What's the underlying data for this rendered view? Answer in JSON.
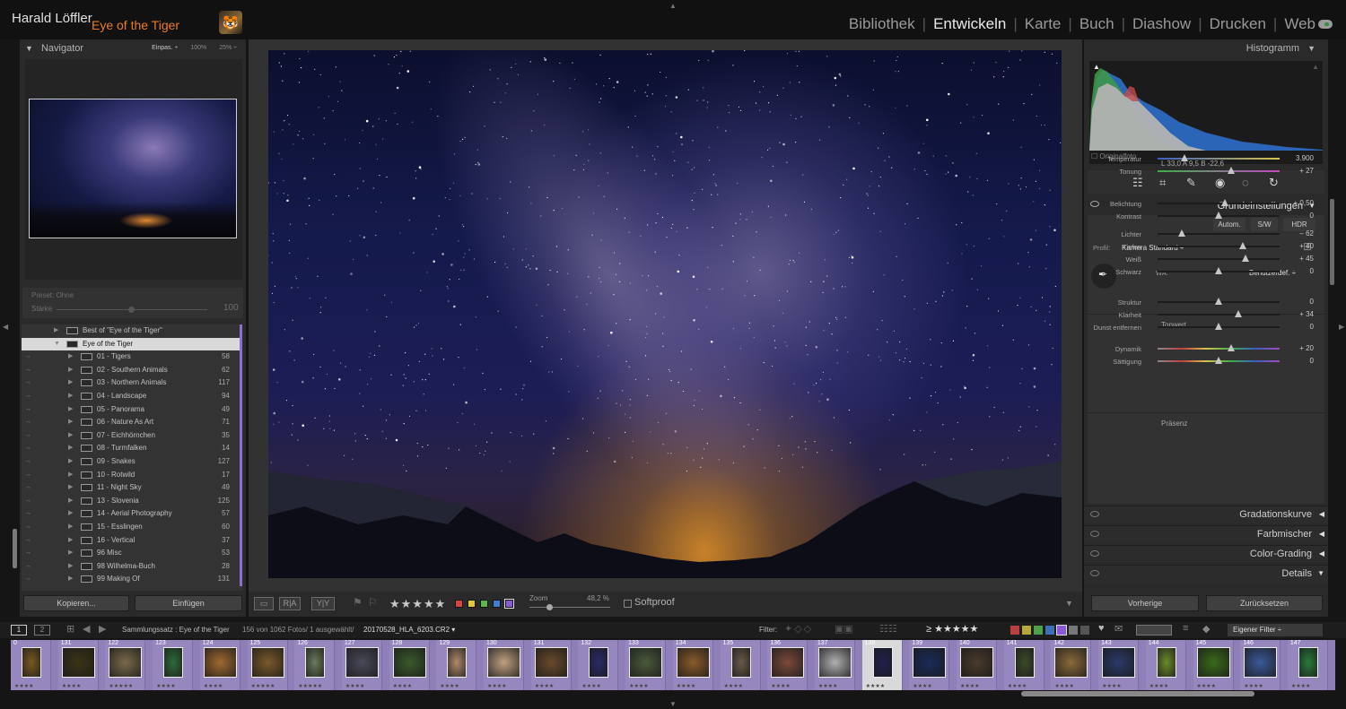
{
  "top": {
    "user": "Harald Löffler",
    "catalog": "Eye of the Tiger",
    "badge": "🐯",
    "modules": [
      "Bibliothek",
      "Entwickeln",
      "Karte",
      "Buch",
      "Diashow",
      "Drucken",
      "Web"
    ],
    "active_module": "Entwickeln"
  },
  "navigator": {
    "title": "Navigator",
    "zoom_options": [
      "Einpas. ÷",
      "100%",
      "25% ÷"
    ]
  },
  "preset": {
    "label": "Preset: Ohne",
    "strength_label": "Stärke",
    "strength_value": "100"
  },
  "collections": [
    {
      "name": "Best of \"Eye of the Tiger\"",
      "count": "",
      "level": 1,
      "selected": false
    },
    {
      "name": "Eye of the Tiger",
      "count": "",
      "level": 1,
      "selected": true
    },
    {
      "name": "01 - Tigers",
      "count": "58",
      "level": 2
    },
    {
      "name": "02 - Southern Animals",
      "count": "62",
      "level": 2
    },
    {
      "name": "03 - Northern Animals",
      "count": "117",
      "level": 2
    },
    {
      "name": "04 - Landscape",
      "count": "94",
      "level": 2
    },
    {
      "name": "05 - Panorama",
      "count": "49",
      "level": 2
    },
    {
      "name": "06 - Nature As Art",
      "count": "71",
      "level": 2
    },
    {
      "name": "07 - Eichhörnchen",
      "count": "35",
      "level": 2
    },
    {
      "name": "08 - Turmfalken",
      "count": "14",
      "level": 2
    },
    {
      "name": "09 - Snakes",
      "count": "127",
      "level": 2
    },
    {
      "name": "10 - Rotwild",
      "count": "17",
      "level": 2
    },
    {
      "name": "11 - Night Sky",
      "count": "49",
      "level": 2
    },
    {
      "name": "13 - Slovenia",
      "count": "125",
      "level": 2
    },
    {
      "name": "14 - Aerial Photography",
      "count": "57",
      "level": 2
    },
    {
      "name": "15 - Esslingen",
      "count": "60",
      "level": 2
    },
    {
      "name": "16 - Vertical",
      "count": "37",
      "level": 2
    },
    {
      "name": "96 Misc",
      "count": "53",
      "level": 2
    },
    {
      "name": "98 Wilhelma-Buch",
      "count": "28",
      "level": 2
    },
    {
      "name": "99 Making Of",
      "count": "131",
      "level": 2
    }
  ],
  "left_buttons": {
    "copy": "Kopieren...",
    "paste": "Einfügen"
  },
  "toolbar": {
    "stars": "★★★★★",
    "zoom_label": "Zoom",
    "zoom_value": "48,2 %",
    "softproof": "Softproof",
    "btn_ra": "R|A",
    "btn_yy": "Y|Y",
    "labels": [
      "#d9433f",
      "#e3c83a",
      "#5cb64a",
      "#3d7fd0",
      "#8a5ad6"
    ]
  },
  "histogram": {
    "title": "Histogramm",
    "readout": "L   33,0   A   9,5   B  -22,6",
    "original": "Originalfoto"
  },
  "basic": {
    "title": "Grundeinstellungen",
    "auto": "Autom.",
    "bw": "S/W",
    "hdr": "HDR",
    "profile_label": "Profil:",
    "profile_value": "Kamera Standard  ÷",
    "wb_label": "WA:",
    "wb_value": "Benutzerdef.  ÷",
    "tonwert": "Tonwert",
    "praesenz": "Präsenz",
    "sliders": [
      {
        "label": "Temperatur",
        "value": "3.900",
        "pos": 0.22,
        "group": "wb"
      },
      {
        "label": "Tonung",
        "value": "+ 27",
        "pos": 0.6,
        "group": "wb"
      },
      {
        "label": "Belichtung",
        "value": "+ 0,50",
        "pos": 0.55,
        "group": "tone"
      },
      {
        "label": "Kontrast",
        "value": "0",
        "pos": 0.5,
        "group": "tone"
      },
      {
        "label": "Lichter",
        "value": "– 62",
        "pos": 0.2,
        "group": "tone2"
      },
      {
        "label": "Tiefen",
        "value": "+ 40",
        "pos": 0.7,
        "group": "tone2"
      },
      {
        "label": "Weiß",
        "value": "+ 45",
        "pos": 0.72,
        "group": "tone2"
      },
      {
        "label": "Schwarz",
        "value": "0",
        "pos": 0.5,
        "group": "tone2"
      },
      {
        "label": "Struktur",
        "value": "0",
        "pos": 0.5,
        "group": "presence"
      },
      {
        "label": "Klarheit",
        "value": "+ 34",
        "pos": 0.66,
        "group": "presence"
      },
      {
        "label": "Dunst entfernen",
        "value": "0",
        "pos": 0.5,
        "group": "presence"
      },
      {
        "label": "Dynamik",
        "value": "+ 20",
        "pos": 0.6,
        "group": "presence2"
      },
      {
        "label": "Sättigung",
        "value": "0",
        "pos": 0.5,
        "group": "presence2"
      }
    ]
  },
  "collapsed_panels": [
    "Gradationskurve",
    "Farbmischer",
    "Color-Grading",
    "Details"
  ],
  "right_buttons": {
    "previous": "Vorherige",
    "reset": "Zurücksetzen"
  },
  "filmbar": {
    "view1": "1",
    "view2": "2",
    "source": "Sammlungssatz : Eye of the Tiger",
    "count_text": "156 von 1062 Fotos/  1 ausgewählt/",
    "filename": "20170528_HLA_6203.CR2 ▾",
    "filter_label": "Filter:",
    "filter_stars": "≥ ★★★★★",
    "custom_filter": "Eigener Filter ÷"
  },
  "film": [
    {
      "n": "0",
      "s": "★★★★"
    },
    {
      "n": "131",
      "s": "★★★★"
    },
    {
      "n": "122",
      "s": "★★★★★"
    },
    {
      "n": "123",
      "s": "★★★★"
    },
    {
      "n": "124",
      "s": "★★★★"
    },
    {
      "n": "125",
      "s": "★★★★★"
    },
    {
      "n": "126",
      "s": "★★★★★"
    },
    {
      "n": "127",
      "s": "★★★★"
    },
    {
      "n": "128",
      "s": "★★★★"
    },
    {
      "n": "129",
      "s": "★★★★"
    },
    {
      "n": "130",
      "s": "★★★★"
    },
    {
      "n": "131",
      "s": "★★★★"
    },
    {
      "n": "132",
      "s": "★★★★"
    },
    {
      "n": "133",
      "s": "★★★★"
    },
    {
      "n": "134",
      "s": "★★★★"
    },
    {
      "n": "135",
      "s": "★★★★"
    },
    {
      "n": "136",
      "s": "★★★★"
    },
    {
      "n": "137",
      "s": "★★★★"
    },
    {
      "n": "138",
      "s": "★★★★"
    },
    {
      "n": "139",
      "s": "★★★★"
    },
    {
      "n": "140",
      "s": "★★★★"
    },
    {
      "n": "141",
      "s": "★★★★"
    },
    {
      "n": "142",
      "s": "★★★★"
    },
    {
      "n": "143",
      "s": "★★★★"
    },
    {
      "n": "144",
      "s": "★★★★"
    },
    {
      "n": "145",
      "s": "★★★★"
    },
    {
      "n": "146",
      "s": "★★★★"
    },
    {
      "n": "147",
      "s": "★★★★"
    }
  ]
}
